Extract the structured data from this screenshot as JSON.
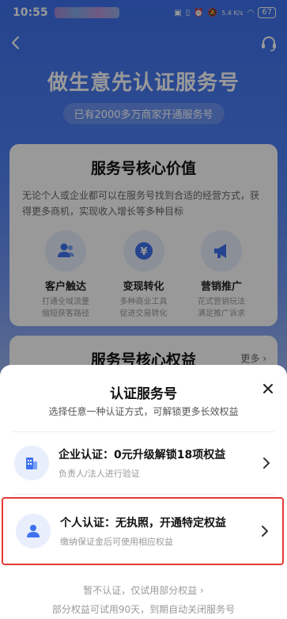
{
  "status_bar": {
    "time": "10:55",
    "network_speed": "5.4 K/s",
    "battery": "67"
  },
  "hero": {
    "title": "做生意先认证服务号",
    "subtitle": "已有2000多万商家开通服务号"
  },
  "value_card": {
    "title": "服务号核心价值",
    "description": "无论个人或企业都可以在服务号找到合适的经营方式，获得更多商机，实现收入增长等多种目标",
    "features": [
      {
        "name": "客户触达",
        "desc1": "打通全域流量",
        "desc2": "缩短获客路径",
        "icon": "users-icon"
      },
      {
        "name": "变现转化",
        "desc1": "多种商业工具",
        "desc2": "促进交易转化",
        "icon": "yen-icon"
      },
      {
        "name": "营销推广",
        "desc1": "花式营销玩法",
        "desc2": "满足推广诉求",
        "icon": "megaphone-icon"
      }
    ]
  },
  "benefit_card": {
    "title": "服务号核心权益",
    "more_label": "更多 ›"
  },
  "sheet": {
    "title": "认证服务号",
    "subtitle": "选择任意一种认证方式，可解锁更多长效权益",
    "options": [
      {
        "title": "企业认证：0元升级解锁18项权益",
        "desc": "负责人/法人进行验证",
        "icon": "building-icon"
      },
      {
        "title": "个人认证：无执照，开通特定权益",
        "desc": "缴纳保证金后可使用相应权益",
        "icon": "person-icon"
      }
    ],
    "skip_label": "暂不认证，仅试用部分权益 ›",
    "footnote": "部分权益可试用90天，到期自动关闭服务号"
  },
  "colors": {
    "accent_blue": "#3f72ee",
    "highlight_red": "#e53935"
  }
}
